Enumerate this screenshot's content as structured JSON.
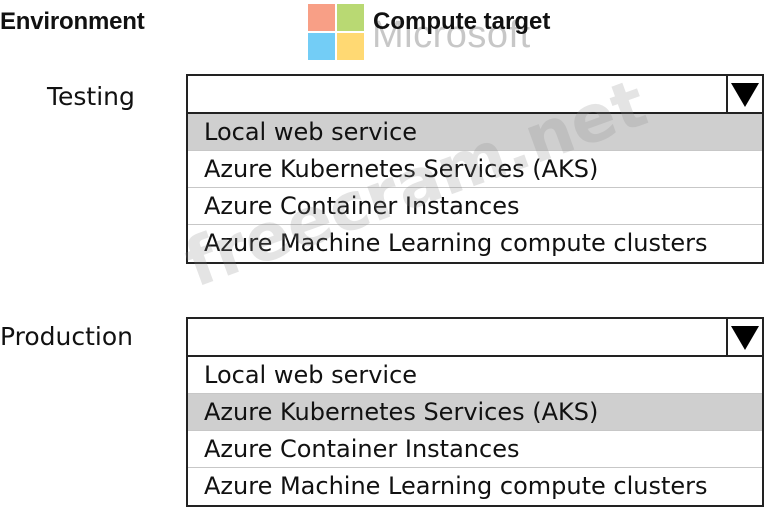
{
  "headers": {
    "environment": "Environment",
    "compute_target": "Compute target"
  },
  "branding": {
    "logo_name": "microsoft-logo-icon",
    "logo_text": "Microsoft",
    "logo_colors": [
      "#f25022",
      "#7fba00",
      "#00a4ef",
      "#ffb900"
    ]
  },
  "watermark": {
    "text": "freecram.net"
  },
  "rows": [
    {
      "label": "Testing",
      "selected_value": "",
      "selected_index": 0,
      "options": [
        "Local web service",
        "Azure Kubernetes Services (AKS)",
        "Azure Container Instances",
        "Azure Machine Learning compute clusters"
      ]
    },
    {
      "label": "Production",
      "selected_value": "",
      "selected_index": 1,
      "options": [
        "Local web service",
        "Azure Kubernetes Services (AKS)",
        "Azure Container Instances",
        "Azure Machine Learning compute clusters"
      ]
    }
  ],
  "colors": {
    "highlight": "#cfcfcf",
    "border": "#222222"
  }
}
